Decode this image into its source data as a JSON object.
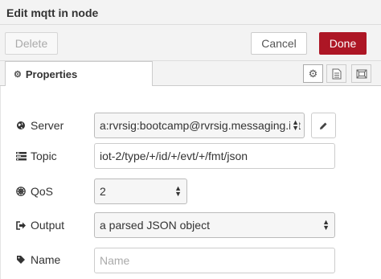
{
  "header": {
    "title": "Edit mqtt in node"
  },
  "toolbar": {
    "delete_label": "Delete",
    "cancel_label": "Cancel",
    "done_label": "Done"
  },
  "tabs": {
    "properties_label": "Properties",
    "icons": [
      "gear-icon",
      "description-icon",
      "appearance-icon"
    ]
  },
  "form": {
    "server": {
      "label": "Server",
      "value": "a:rvrsig:bootcamp@rvrsig.messaging.int"
    },
    "topic": {
      "label": "Topic",
      "value": "iot-2/type/+/id/+/evt/+/fmt/json"
    },
    "qos": {
      "label": "QoS",
      "value": "2"
    },
    "output": {
      "label": "Output",
      "value": "a parsed JSON object"
    },
    "name": {
      "label": "Name",
      "placeholder": "Name",
      "value": ""
    }
  },
  "colors": {
    "done_button": "#ad1625",
    "toolbar_bg": "#f3f3f3"
  }
}
